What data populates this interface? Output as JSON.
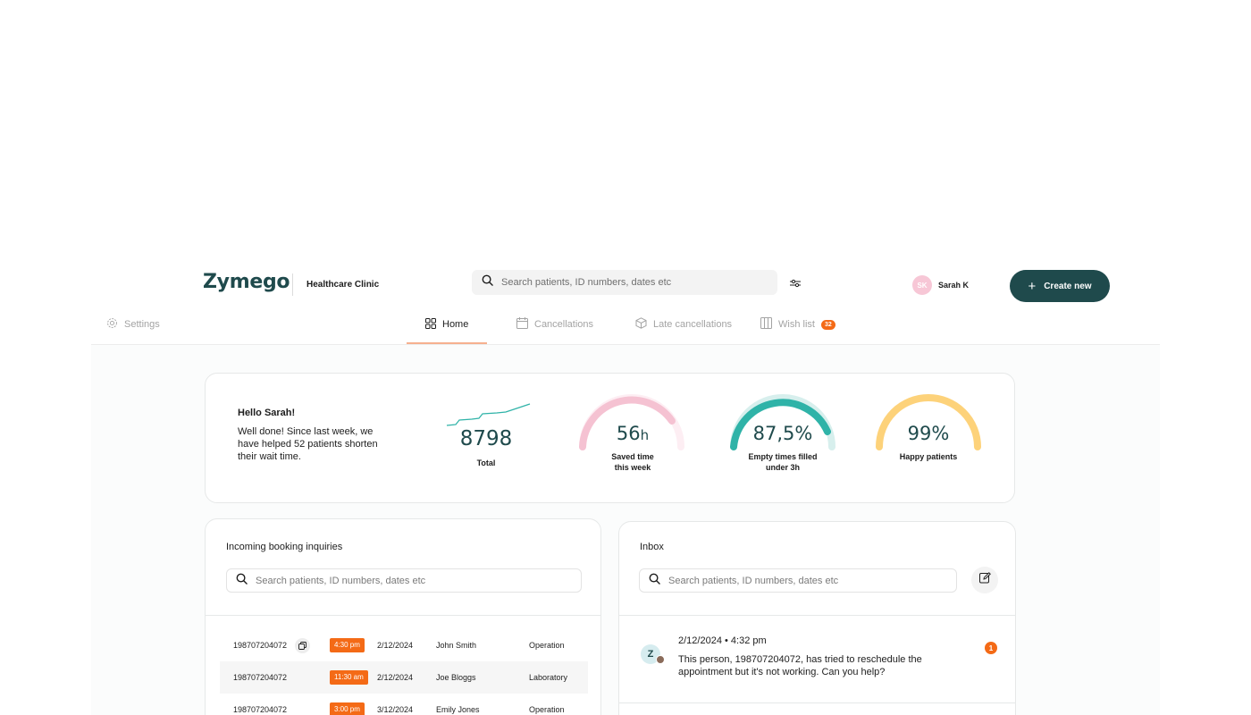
{
  "header": {
    "logo": "Zymego",
    "clinic": "Healthcare Clinic",
    "search_placeholder": "Search patients, ID numbers, dates etc",
    "user_initials": "SK",
    "user_name": "Sarah K",
    "create_label": "Create new"
  },
  "nav": {
    "settings": "Settings",
    "tabs": [
      {
        "label": "Home",
        "active": true
      },
      {
        "label": "Cancellations",
        "active": false
      },
      {
        "label": "Late cancellations",
        "active": false
      },
      {
        "label": "Wish list",
        "active": false,
        "badge": "32"
      }
    ]
  },
  "stats": {
    "greeting": "Hello Sarah!",
    "message": "Well done! Since last week, we have helped 52 patients shorten their wait time.",
    "total_value": "8798",
    "total_label": "Total",
    "saved_value": "56",
    "saved_unit": "h",
    "saved_label_1": "Saved time",
    "saved_label_2": "this week",
    "empty_value": "87,5%",
    "empty_fraction": 0.875,
    "empty_label_1": "Empty times filled",
    "empty_label_2": "under 3h",
    "happy_value": "99%",
    "happy_fraction": 0.99,
    "happy_label": "Happy patients"
  },
  "inquiries": {
    "title": "Incoming booking inquiries",
    "search_placeholder": "Search patients, ID numbers, dates etc",
    "rows": [
      {
        "id": "198707204072",
        "time": "4:30 pm",
        "date": "2/12/2024",
        "name": "John Smith",
        "type": "Operation"
      },
      {
        "id": "198707204072",
        "time": "11:30 am",
        "date": "2/12/2024",
        "name": "Joe Bloggs",
        "type": "Laboratory"
      },
      {
        "id": "198707204072",
        "time": "3:00 pm",
        "date": "3/12/2024",
        "name": "Emily Jones",
        "type": "Operation"
      }
    ]
  },
  "inbox": {
    "title": "Inbox",
    "search_placeholder": "Search patients, ID numbers, dates etc",
    "message": {
      "avatar_letter": "Z",
      "date": "2/12/2024 • 4:32 pm",
      "text": "This person, 198707204072, has tried to reschedule the appointment but it's not working. Can you help?",
      "unread": "1"
    }
  },
  "colors": {
    "brand": "#1f4a4c",
    "accent_orange": "#f46a16",
    "gauge_pink": "#f5c2d2",
    "gauge_teal": "#2fb3a8",
    "gauge_yellow": "#fdd27a"
  }
}
